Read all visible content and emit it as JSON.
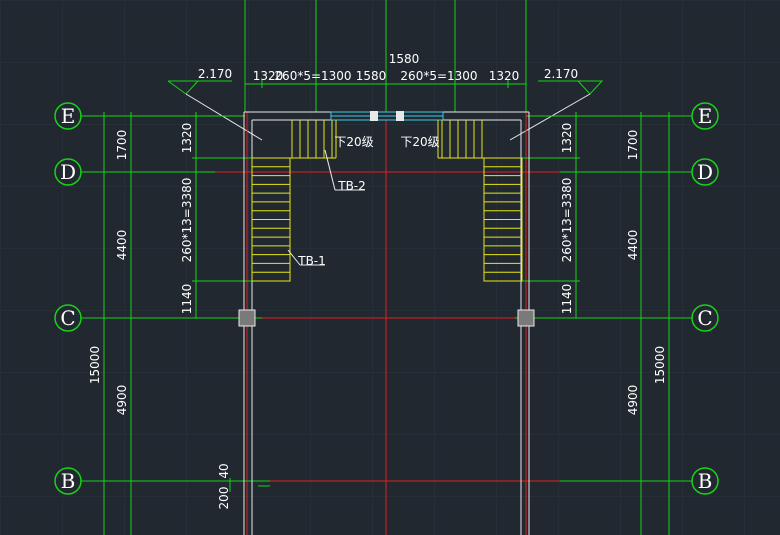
{
  "drawing": {
    "colors": {
      "background": "#212830",
      "grid": "#2c3440",
      "axis_line": "#e02020",
      "dimension_line": "#19d219",
      "wall_white": "#e8e8e8",
      "stair_yellow": "#e6e619",
      "window_cyan": "#40c8e8",
      "text": "#ffffff",
      "column_fill": "#7a7a7a"
    },
    "axes": {
      "E": "E",
      "D": "D",
      "C": "C",
      "B": "B"
    },
    "top_dims": {
      "overall": "1580",
      "left_landing": "1320",
      "left_steps": "260*5=1300",
      "middle": "1580",
      "right_steps": "260*5=1300",
      "right_landing": "1320"
    },
    "elevations": {
      "left": "2.170",
      "right": "2.170"
    },
    "left_vertical_dims": {
      "ed": "1700",
      "dc": "4400",
      "cb": "4900",
      "total": "15000",
      "landing": "1320",
      "flight": "260*13=3380",
      "bottom": "1140",
      "small_200": "200",
      "small_40": "40"
    },
    "right_vertical_dims": {
      "ed": "1700",
      "dc": "4400",
      "cb": "4900",
      "total": "15000",
      "landing": "1320",
      "flight": "260*13=3380",
      "bottom": "1140"
    },
    "stair_labels": {
      "tb1": "TB-1",
      "tb2": "TB-2",
      "down_left": "下20级",
      "down_right": "下20级"
    }
  }
}
